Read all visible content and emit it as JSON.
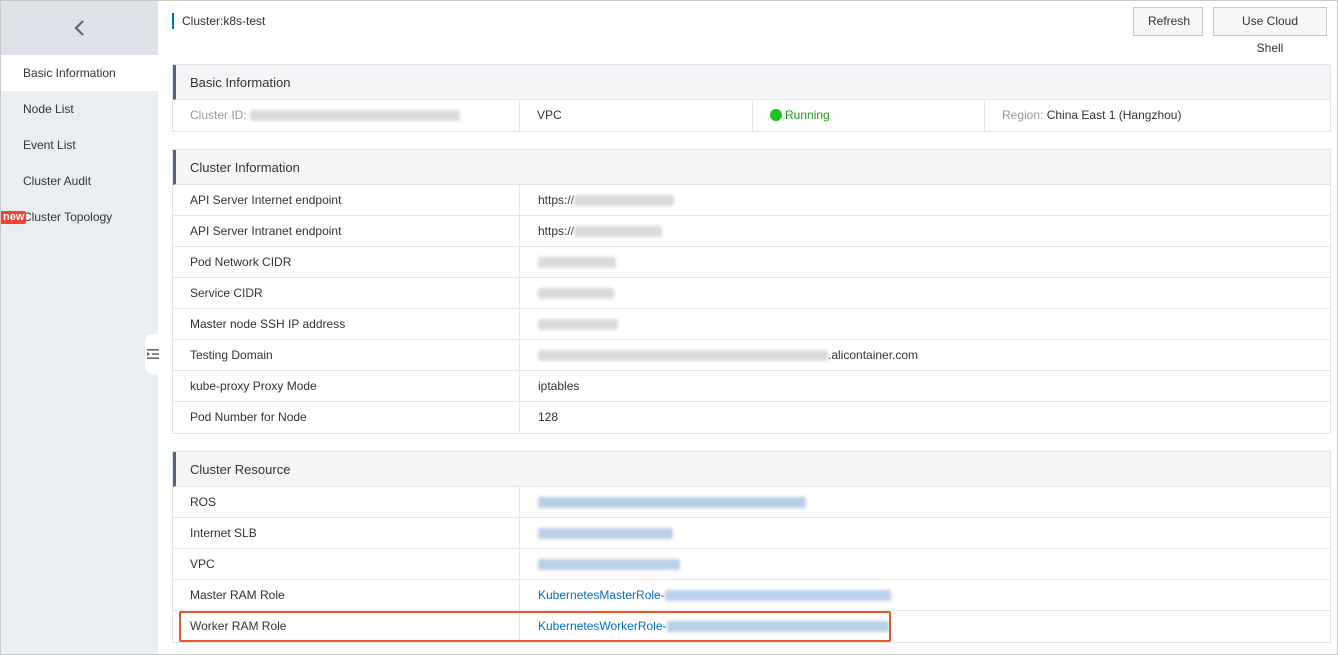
{
  "sidebar": {
    "items": [
      {
        "label": "Basic Information"
      },
      {
        "label": "Node List"
      },
      {
        "label": "Event List"
      },
      {
        "label": "Cluster Audit"
      },
      {
        "label": "Cluster Topology",
        "badge": "new"
      }
    ]
  },
  "header": {
    "title": "Cluster:k8s-test",
    "refresh_label": "Refresh",
    "shell_label": "Use Cloud Shell"
  },
  "basic": {
    "heading": "Basic Information",
    "cluster_id_label": "Cluster ID:",
    "network": "VPC",
    "status": "Running",
    "region_label": "Region:",
    "region_value": "China East 1 (Hangzhou)"
  },
  "cluster_info": {
    "heading": "Cluster Information",
    "rows": [
      {
        "label": "API Server Internet endpoint",
        "value": "https://"
      },
      {
        "label": "API Server Intranet endpoint",
        "value": "https://"
      },
      {
        "label": "Pod Network CIDR",
        "value": ""
      },
      {
        "label": "Service CIDR",
        "value": ""
      },
      {
        "label": "Master node SSH IP address",
        "value": ""
      },
      {
        "label": "Testing Domain",
        "value": ".alicontainer.com"
      },
      {
        "label": "kube-proxy Proxy Mode",
        "value": "iptables"
      },
      {
        "label": "Pod Number for Node",
        "value": "128"
      }
    ]
  },
  "cluster_resource": {
    "heading": "Cluster Resource",
    "rows": [
      {
        "label": "ROS",
        "value": ""
      },
      {
        "label": "Internet SLB",
        "value": ""
      },
      {
        "label": "VPC",
        "value": ""
      },
      {
        "label": "Master RAM Role",
        "value": "KubernetesMasterRole-"
      },
      {
        "label": "Worker RAM Role",
        "value": "KubernetesWorkerRole-"
      }
    ]
  },
  "colors": {
    "accent": "#0070cc",
    "running": "#1ec31e",
    "highlight": "#e8582b",
    "badge": "#f04134"
  }
}
